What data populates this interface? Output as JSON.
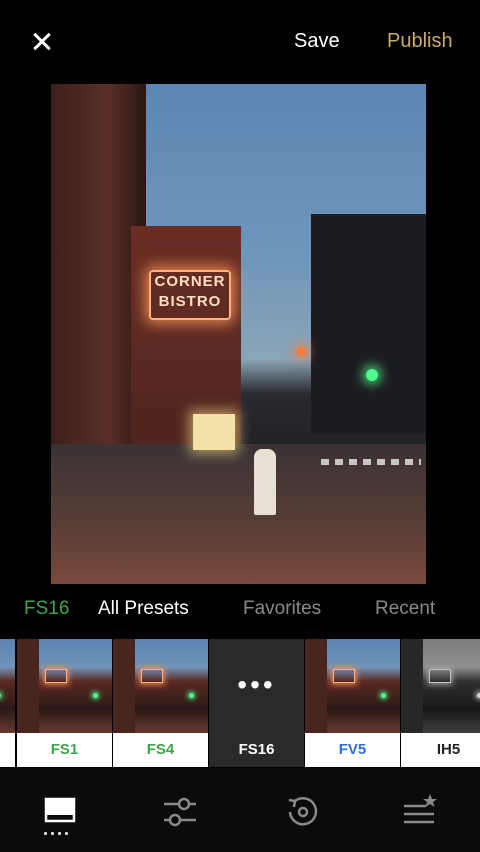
{
  "header": {
    "close_label": "close",
    "save_label": "Save",
    "publish_label": "Publish",
    "publish_color": "#c9ab6b"
  },
  "photo": {
    "sign_text": "CORNER BISTRO"
  },
  "tabs": {
    "current": "FS16",
    "current_color": "#3fa54a",
    "items": [
      "All Presets",
      "Favorites",
      "Recent"
    ]
  },
  "presets": [
    {
      "label": "FS1",
      "color": "#3fa54a"
    },
    {
      "label": "FS4",
      "color": "#3fa54a"
    },
    {
      "label": "FS16",
      "color": "#ffffff",
      "selected": true
    },
    {
      "label": "FV5",
      "color": "#2f6fcf"
    },
    {
      "label": "IH5",
      "color": "#222222"
    }
  ],
  "toolbar": {
    "icons": [
      "library-icon",
      "adjust-icon",
      "revert-icon",
      "recipes-icon"
    ]
  }
}
